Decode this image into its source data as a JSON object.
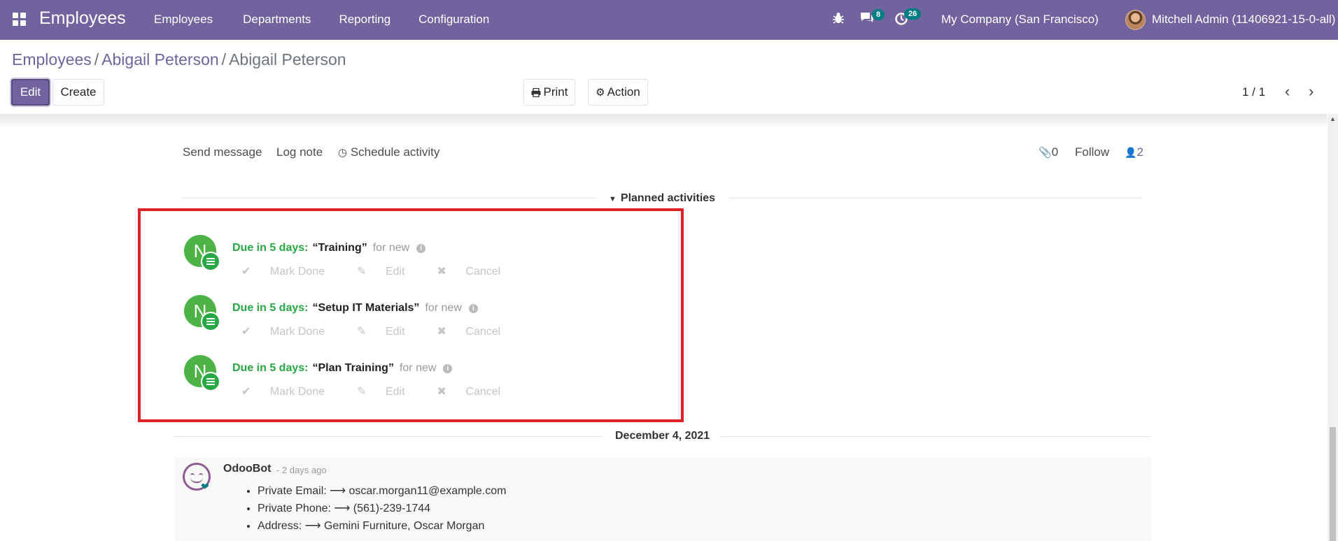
{
  "navbar": {
    "app_title": "Employees",
    "menu": [
      "Employees",
      "Departments",
      "Reporting",
      "Configuration"
    ],
    "messages_count": "8",
    "activities_count": "26",
    "company": "My Company (San Francisco)",
    "user": "Mitchell Admin (11406921-15-0-all)",
    "color": "#71639e"
  },
  "breadcrumb": {
    "root": "Employees",
    "parent": "Abigail Peterson",
    "current": "Abigail Peterson"
  },
  "buttons": {
    "edit": "Edit",
    "create": "Create",
    "print": "Print",
    "action": "Action"
  },
  "pager": {
    "value": "1 / 1"
  },
  "chatter": {
    "send_message": "Send message",
    "log_note": "Log note",
    "schedule_activity": "Schedule activity",
    "attachments": "0",
    "follow": "Follow",
    "followers": "2",
    "planned_title": "Planned activities",
    "activities": [
      {
        "avatar": "N",
        "due": "Due in 5 days:",
        "summary": "“Training”",
        "assignee": "for new"
      },
      {
        "avatar": "N",
        "due": "Due in 5 days:",
        "summary": "“Setup IT Materials”",
        "assignee": "for new"
      },
      {
        "avatar": "N",
        "due": "Due in 5 days:",
        "summary": "“Plan Training”",
        "assignee": "for new"
      }
    ],
    "actions": {
      "mark_done": "Mark Done",
      "edit": "Edit",
      "cancel": "Cancel"
    },
    "date_separator": "December 4, 2021",
    "message": {
      "author": "OdooBot",
      "date": "- 2 days ago",
      "tracking": [
        "Private Email: ⟶ oscar.morgan11@example.com",
        "Private Phone: ⟶ (561)-239-1744",
        "Address: ⟶ Gemini Furniture, Oscar Morgan"
      ]
    }
  },
  "colors": {
    "due": "#28a745",
    "highlight": "#e02027",
    "badge": "#017e84"
  }
}
